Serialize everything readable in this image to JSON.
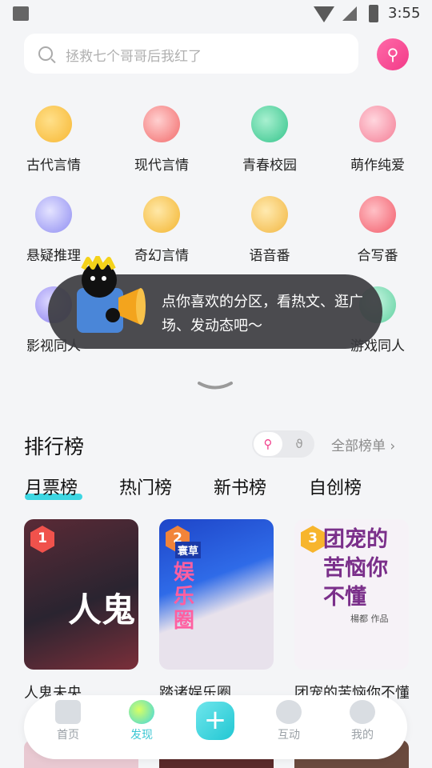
{
  "status_bar": {
    "time": "3:55"
  },
  "search": {
    "placeholder": "拯救七个哥哥后我红了"
  },
  "categories": [
    {
      "label": "古代言情",
      "icon": "fan-icon",
      "color": "#f7b733"
    },
    {
      "label": "现代言情",
      "icon": "coffee-cup-icon",
      "color": "#f26a6a"
    },
    {
      "label": "青春校园",
      "icon": "graduation-cap-icon",
      "color": "#34c48b"
    },
    {
      "label": "萌作纯爱",
      "icon": "bear-face-icon",
      "color": "#f47d95"
    },
    {
      "label": "悬疑推理",
      "icon": "crystal-ball-icon",
      "color": "#8f8df2"
    },
    {
      "label": "奇幻言情",
      "icon": "wing-icon",
      "color": "#f3b42e"
    },
    {
      "label": "语音番",
      "icon": "microphone-icon",
      "color": "#f2b640"
    },
    {
      "label": "合写番",
      "icon": "heart-icon",
      "color": "#f25c6a"
    },
    {
      "label": "影视同人",
      "icon": "film-icon",
      "color": "#8a7ef0"
    },
    {
      "label": "游戏同人",
      "icon": "gamepad-icon",
      "color": "#5fd1a0"
    }
  ],
  "tooltip": {
    "text": "点你喜欢的分区，看热文、逛广场、发动态吧～"
  },
  "ranking": {
    "title": "排行榜",
    "all_link": "全部榜单 ›",
    "tabs": [
      "月票榜",
      "热门榜",
      "新书榜",
      "自创榜"
    ],
    "books": [
      {
        "rank": "1",
        "cover_text": "人鬼",
        "title": "人鬼未央",
        "badge_color": "#f0524c"
      },
      {
        "rank": "2",
        "cover_text": "娱乐圈",
        "cover_sub": "寰草",
        "title": "踏诸娱乐圈",
        "badge_color": "#f2843a"
      },
      {
        "rank": "3",
        "cover_text": "团宠的苦恼你不懂",
        "cover_sub": "楊都 作品",
        "title": "团宠的苦恼你不懂",
        "badge_color": "#f7b52d"
      }
    ]
  },
  "bottom_nav": {
    "items": [
      {
        "label": "首页",
        "icon": "home-icon"
      },
      {
        "label": "发现",
        "icon": "discover-icon",
        "active": true
      },
      {
        "label": "互动",
        "icon": "chat-icon"
      },
      {
        "label": "我的",
        "icon": "profile-icon"
      }
    ]
  },
  "colors": {
    "accent": "#3dd6e2",
    "pink": "#f2418d"
  }
}
